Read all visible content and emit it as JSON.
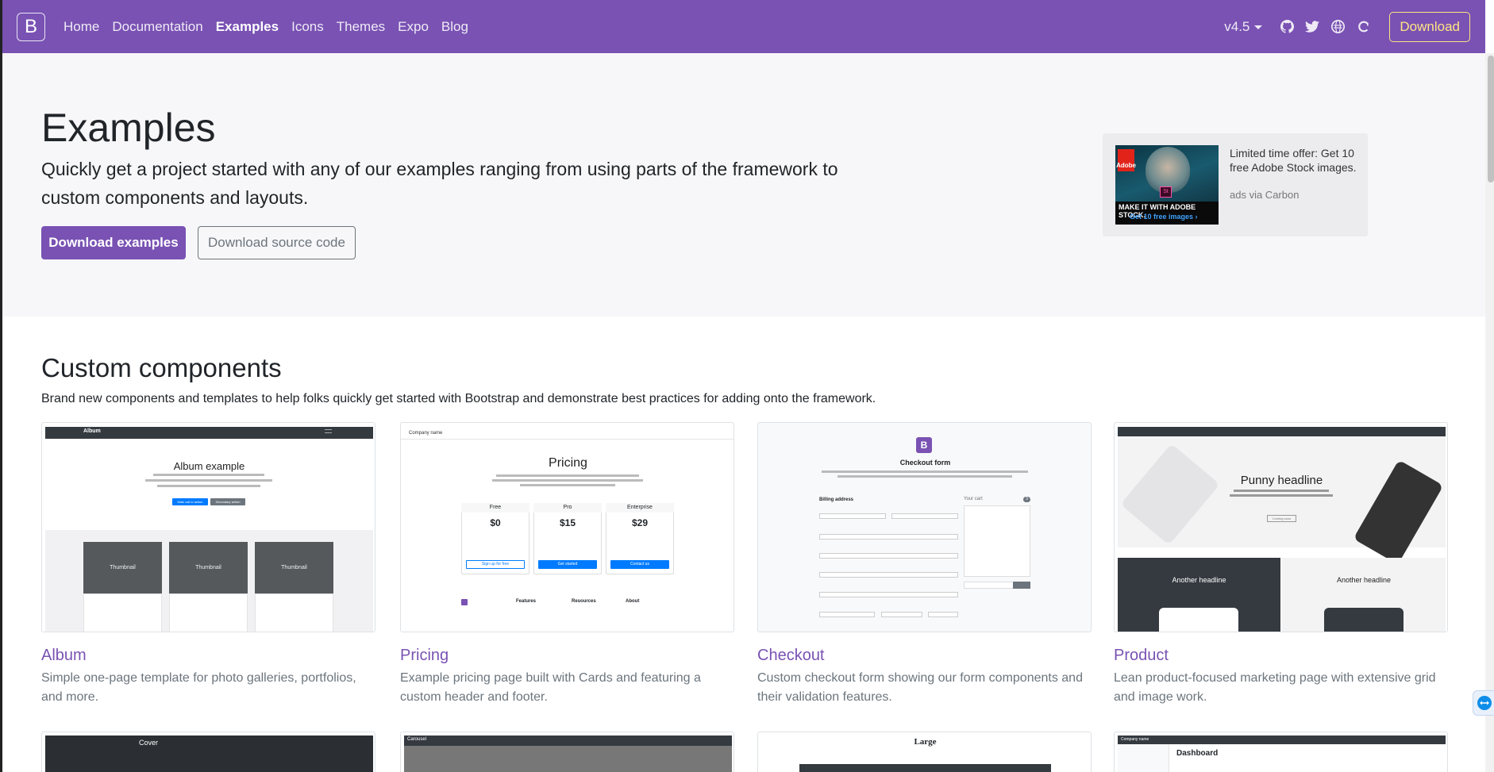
{
  "nav": {
    "brand": "B",
    "links": [
      "Home",
      "Documentation",
      "Examples",
      "Icons",
      "Themes",
      "Expo",
      "Blog"
    ],
    "active": "Examples",
    "version": "v4.5",
    "download": "Download"
  },
  "hero": {
    "title": "Examples",
    "lead": "Quickly get a project started with any of our examples ranging from using parts of the framework to custom components and layouts.",
    "btn_download_examples": "Download examples",
    "btn_download_source": "Download source code"
  },
  "ad": {
    "text": "Limited time offer: Get 10 free Adobe Stock images.",
    "via": "ads via Carbon",
    "logo": "Adobe",
    "badge": "St",
    "tagline": "MAKE IT WITH ADOBE STOCK.",
    "cta": "Get 10 free images ›"
  },
  "section": {
    "title": "Custom components",
    "description": "Brand new components and templates to help folks quickly get started with Bootstrap and demonstrate best practices for adding onto the framework."
  },
  "cards": [
    {
      "title": "Album",
      "description": "Simple one-page template for photo galleries, portfolios, and more."
    },
    {
      "title": "Pricing",
      "description": "Example pricing page built with Cards and featuring a custom header and footer."
    },
    {
      "title": "Checkout",
      "description": "Custom checkout form showing our form components and their validation features."
    },
    {
      "title": "Product",
      "description": "Lean product-focused marketing page with extensive grid and image work."
    }
  ],
  "thumbs": {
    "album": {
      "brand": "Album",
      "heading": "Album example",
      "btn1": "Main call to action",
      "btn2": "Secondary action",
      "thumb": "Thumbnail"
    },
    "pricing": {
      "company": "Company name",
      "heading": "Pricing",
      "plans": [
        "Free",
        "Pro",
        "Enterprise"
      ],
      "prices": [
        "$0",
        "$15",
        "$29"
      ],
      "per": "/ mo",
      "buttons": [
        "Sign up for free",
        "Get started",
        "Contact us"
      ],
      "footer_cols": [
        "Features",
        "Resources",
        "About"
      ]
    },
    "checkout": {
      "heading": "Checkout form",
      "billing": "Billing address",
      "cart": "Your cart",
      "badge": "3"
    },
    "product": {
      "heading": "Punny headline",
      "sub": "Coming soon",
      "h2a": "Another headline",
      "h2b": "Another headline"
    },
    "row2": {
      "cover": "Cover",
      "carousel": "Carousel",
      "blog": "Large",
      "dashboard": "Dashboard",
      "company": "Company name"
    }
  },
  "colors": {
    "primary": "#7952b3",
    "accent": "#ffe484",
    "hero_bg": "#f7f7f9"
  }
}
